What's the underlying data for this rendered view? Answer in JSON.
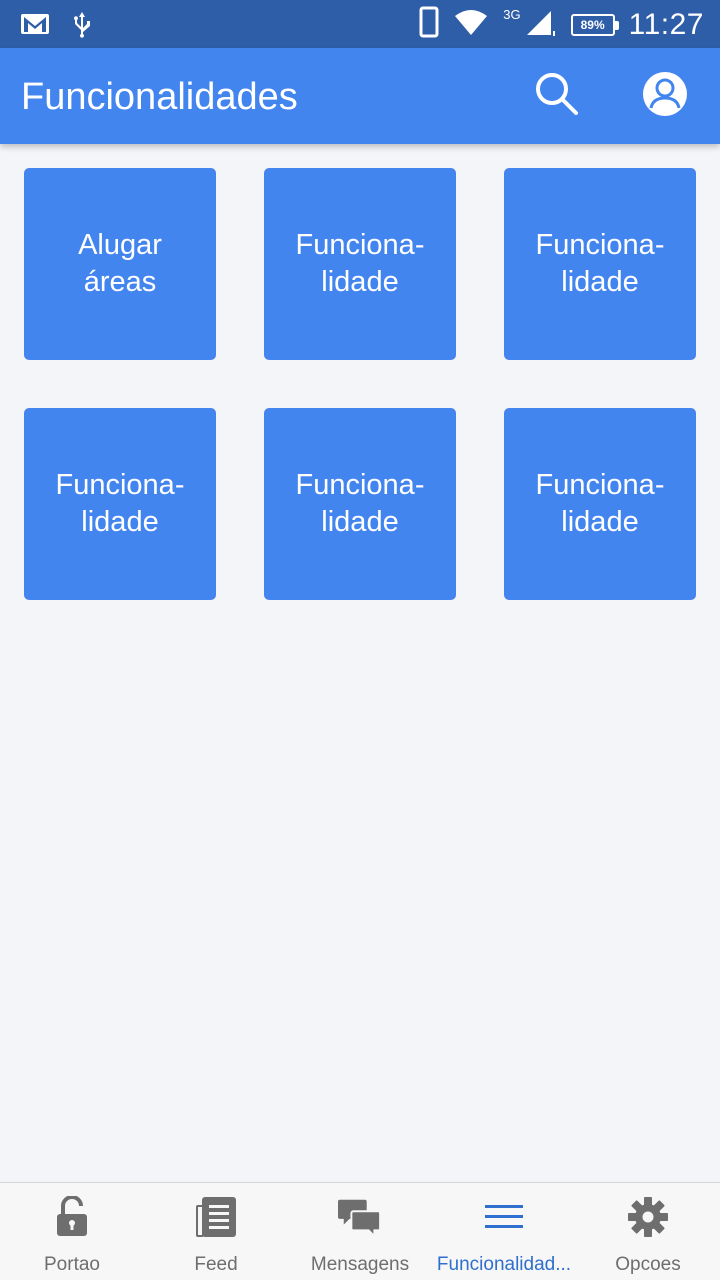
{
  "status_bar": {
    "network_label": "3G",
    "battery": "89%",
    "time": "11:27"
  },
  "app_bar": {
    "title": "Funcionalidades",
    "search_icon": "search-icon",
    "profile_icon": "account-circle-icon"
  },
  "tiles": [
    {
      "label": "Alugar\náreas"
    },
    {
      "label": "Funciona-\nlidade"
    },
    {
      "label": "Funciona-\nlidade"
    },
    {
      "label": "Funciona-\nlidade"
    },
    {
      "label": "Funciona-\nlidade"
    },
    {
      "label": "Funciona-\nlidade"
    }
  ],
  "bottom_nav": {
    "items": [
      {
        "label": "Portao",
        "icon": "lock-icon",
        "active": false
      },
      {
        "label": "Feed",
        "icon": "feed-icon",
        "active": false
      },
      {
        "label": "Mensagens",
        "icon": "chat-icon",
        "active": false
      },
      {
        "label": "Funcionalidad...",
        "icon": "menu-icon",
        "active": true
      },
      {
        "label": "Opcoes",
        "icon": "gear-icon",
        "active": false
      }
    ]
  },
  "colors": {
    "status_bar": "#2F5EA8",
    "primary": "#4385EF",
    "background": "#F3F5F8",
    "nav_active": "#2F6FCF",
    "nav_inactive": "#6E6E6E"
  }
}
